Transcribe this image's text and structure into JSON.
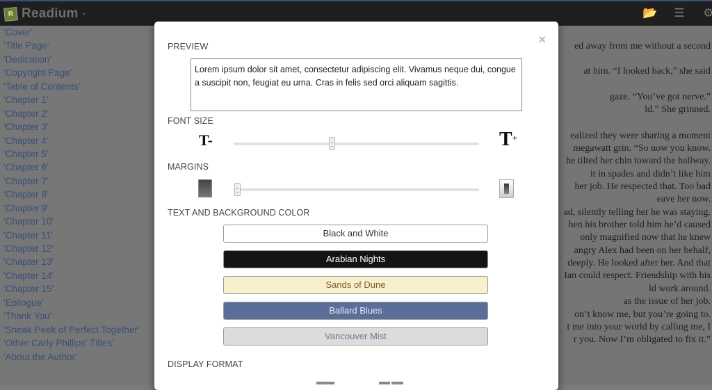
{
  "app": {
    "name": "Readium",
    "logo_glyph": "R",
    "caret_glyph": "▾"
  },
  "navbar": {
    "icons": [
      {
        "name": "folder-icon",
        "glyph": "📂"
      },
      {
        "name": "list-icon",
        "glyph": "☰"
      },
      {
        "name": "gear-icon",
        "glyph": "⚙"
      }
    ]
  },
  "toc": {
    "items": [
      "'Cover'",
      "'Title Page'",
      "'Dedication'",
      "'Copyright Page'",
      "'Table of Contents'",
      "'Chapter 1'",
      "'Chapter 2'",
      "'Chapter 3'",
      "'Chapter 4'",
      "'Chapter 5'",
      "'Chapter 6'",
      "'Chapter 7'",
      "'Chapter 8'",
      "'Chapter 9'",
      "'Chapter 10'",
      "'Chapter 11'",
      "'Chapter 12'",
      "'Chapter 13'",
      "'Chapter 14'",
      "'Chapter 15'",
      "'Epilogue'",
      "'Thank You'",
      "'Sneak Peek of Perfect Together'",
      "'Other Carly Phillips' Titles'",
      "'About the Author'"
    ]
  },
  "reader": {
    "lines": [
      "ed away from me without a second",
      "at him. “I looked back,” she said",
      "gaze. “You’ve got nerve.”",
      "ld.” She grinned.",
      "ealized they were sharing a moment",
      "megawatt grin. “So now you know.",
      "he tilted her chin toward the hallway.",
      "it in spades and didn’t like him",
      "her job. He respected that. Too bad",
      "eave her now.",
      "ad, silently telling her he was staying.",
      "hen his brother told him he’d caused",
      "only magnified now that he knew",
      "angry Alex had been on her behalf,",
      "deeply. He looked after her. And that",
      "Ian could respect. Friendship with his",
      "ld work around.",
      "as the issue of her job.",
      "on’t know me, but you’re going to.",
      "t me into your world by calling me, I",
      "r you. Now I’m obligated to fix it.”"
    ]
  },
  "settings": {
    "close_glyph": "×",
    "preview": {
      "label": "PREVIEW",
      "text": "Lorem ipsum dolor sit amet, consectetur adipiscing elit. Vivamus neque dui, congue a suscipit non, feugiat eu urna. Cras in felis sed orci aliquam sagittis."
    },
    "font_size": {
      "label": "FONT SIZE",
      "decrease_glyph": "T-",
      "increase_glyph": "T",
      "increase_sup": "+",
      "value_fraction": 0.4
    },
    "margins": {
      "label": "MARGINS",
      "value_fraction": 0.0
    },
    "color": {
      "label": "TEXT AND BACKGROUND COLOR",
      "themes": [
        {
          "label": "Black and White",
          "bg": "#ffffff",
          "fg": "#333333"
        },
        {
          "label": "Arabian Nights",
          "bg": "#141414",
          "fg": "#ffffff"
        },
        {
          "label": "Sands of Dune",
          "bg": "#f8efcc",
          "fg": "#7a5c30"
        },
        {
          "label": "Ballard Blues",
          "bg": "#5b6e9a",
          "fg": "#e6e9f2"
        },
        {
          "label": "Vancouver Mist",
          "bg": "#dcdcdc",
          "fg": "#6d7590"
        }
      ]
    },
    "display_format": {
      "label": "DISPLAY FORMAT"
    }
  }
}
